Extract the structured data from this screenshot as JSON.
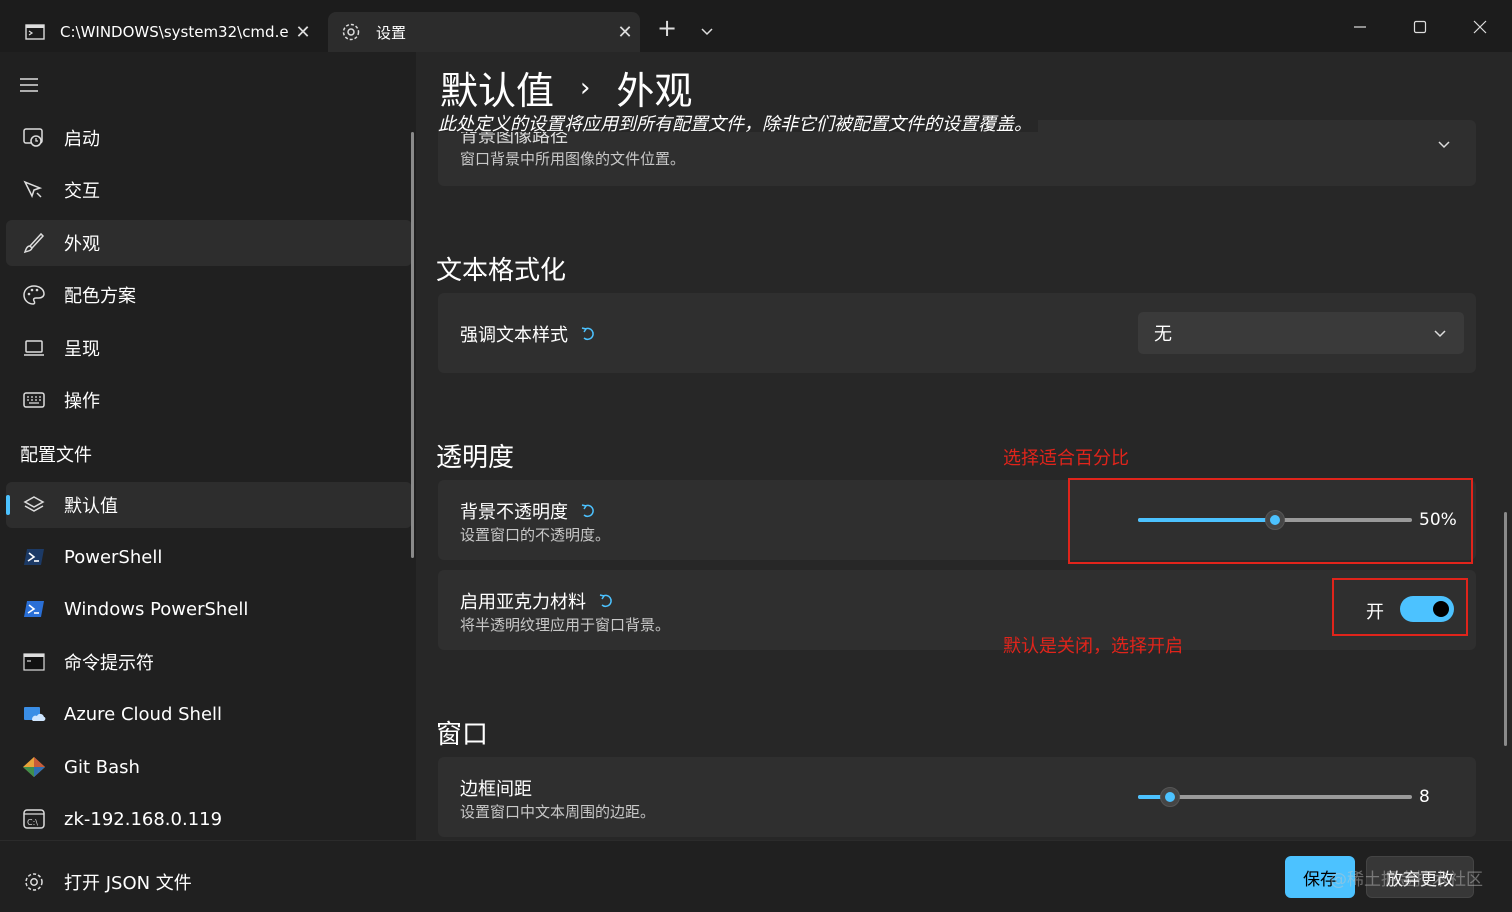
{
  "titlebar": {
    "tabs": [
      {
        "label": "C:\\WINDOWS\\system32\\cmd.e",
        "icon": "terminal-icon"
      },
      {
        "label": "设置",
        "icon": "gear-icon"
      }
    ],
    "new_tab": "+",
    "close": "✕"
  },
  "sidebar": {
    "items": [
      {
        "label": "启动",
        "icon": "startup-icon"
      },
      {
        "label": "交互",
        "icon": "interaction-icon"
      },
      {
        "label": "外观",
        "icon": "brush-icon"
      },
      {
        "label": "配色方案",
        "icon": "palette-icon"
      },
      {
        "label": "呈现",
        "icon": "laptop-icon"
      },
      {
        "label": "操作",
        "icon": "keyboard-icon"
      }
    ],
    "profiles_header": "配置文件",
    "profiles": [
      {
        "label": "默认值",
        "icon": "layers-icon"
      },
      {
        "label": "PowerShell",
        "icon": "powershell-icon"
      },
      {
        "label": "Windows PowerShell",
        "icon": "windows-powershell-icon"
      },
      {
        "label": "命令提示符",
        "icon": "cmd-icon"
      },
      {
        "label": "Azure Cloud Shell",
        "icon": "azure-icon"
      },
      {
        "label": "Git Bash",
        "icon": "git-icon"
      },
      {
        "label": "zk-192.168.0.119",
        "icon": "cmd-c-icon"
      }
    ]
  },
  "bottom": {
    "open_json": "打开 JSON 文件",
    "save": "保存",
    "discard": "放弃更改",
    "watermark": "@稀土掘金技术社区"
  },
  "main": {
    "breadcrumb_parent": "默认值",
    "breadcrumb_sep": "›",
    "breadcrumb_current": "外观",
    "subtitle": "此处定义的设置将应用到所有配置文件，除非它们被配置文件的设置覆盖。",
    "bg_image": {
      "title": "背景图像路径",
      "desc": "窗口背景中所用图像的文件位置。"
    },
    "text_format": {
      "heading": "文本格式化",
      "setting": "强调文本样式",
      "value": "无"
    },
    "transparency": {
      "heading": "透明度",
      "opacity_title": "背景不透明度",
      "opacity_desc": "设置窗口的不透明度。",
      "opacity_value": "50%",
      "opacity_level": 0.5,
      "acrylic_title": "启用亚克力材料",
      "acrylic_desc": "将半透明纹理应用于窗口背景。",
      "acrylic_state": "开"
    },
    "window": {
      "heading": "窗口",
      "padding_title": "边框间距",
      "padding_desc": "设置窗口中文本周围的边距。",
      "padding_value": "8"
    }
  },
  "annotations": {
    "slider_note": "选择适合百分比",
    "toggle_note": "默认是关闭，选择开启"
  },
  "colors": {
    "accent": "#4cc2ff",
    "annotation": "#e0241b"
  }
}
